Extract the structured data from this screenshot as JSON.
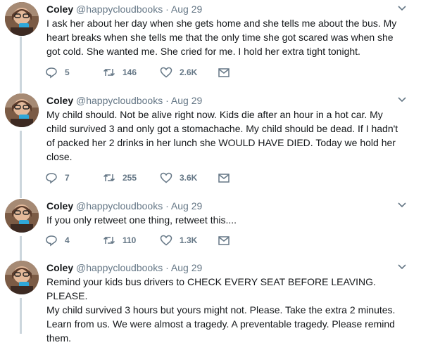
{
  "tweets": [
    {
      "name": "Coley",
      "handle": "@happycloudbooks",
      "sep": "·",
      "date": "Aug 29",
      "lines": [
        "I ask her about her day when she gets home and she tells me about the bus. My",
        "heart breaks when she tells me that the only time she got scared was when she",
        "got cold. She wanted me. She cried for me. I hold her extra tight tonight."
      ],
      "replies": "5",
      "retweets": "146",
      "likes": "2.6K"
    },
    {
      "name": "Coley",
      "handle": "@happycloudbooks",
      "sep": "·",
      "date": "Aug 29",
      "lines": [
        "My child should. Not be alive right now. Kids die after an hour in a hot car. My",
        "child survived 3 and only got a stomachache. My child should be dead. If I hadn't",
        "of packed her 2 drinks in her lunch she WOULD HAVE DIED. Today we hold her",
        "close."
      ],
      "replies": "7",
      "retweets": "255",
      "likes": "3.6K"
    },
    {
      "name": "Coley",
      "handle": "@happycloudbooks",
      "sep": "·",
      "date": "Aug 29",
      "lines": [
        "If you only retweet one thing, retweet this...."
      ],
      "replies": "4",
      "retweets": "110",
      "likes": "1.3K"
    },
    {
      "name": "Coley",
      "handle": "@happycloudbooks",
      "sep": "·",
      "date": "Aug 29",
      "lines": [
        "Remind your kids bus drivers to CHECK EVERY SEAT BEFORE LEAVING. PLEASE.",
        "My child survived 3 hours but yours might not. Please. Take the extra 2 minutes.",
        "Learn from us. We were almost a tragedy. A preventable tragedy. Please remind",
        "them."
      ]
    }
  ],
  "icons": {
    "reply": "reply-icon",
    "retweet": "retweet-icon",
    "like": "heart-icon",
    "dm": "envelope-icon",
    "caret": "chevron-down-icon"
  },
  "colors": {
    "text": "#14171a",
    "secondary": "#657786",
    "thread_line": "#ccd6dd"
  }
}
